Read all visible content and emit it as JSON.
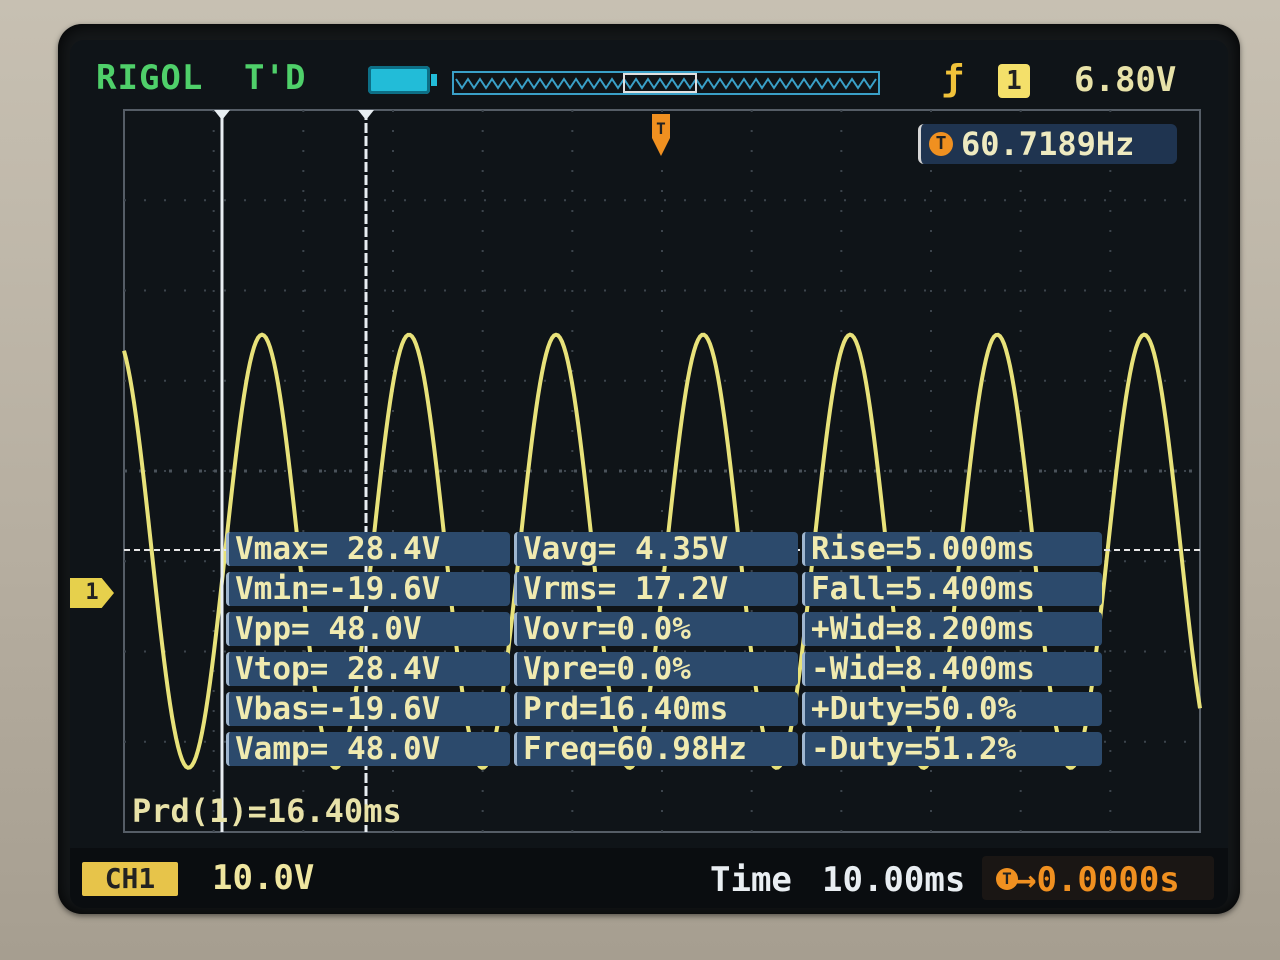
{
  "header": {
    "brand": "RIGOL",
    "trigger_status": "T'D",
    "trigger_source": "1",
    "trigger_level": "6.80V",
    "edge_icon": "rising-edge-icon",
    "battery_icon": "battery-icon"
  },
  "freq_counter": {
    "label": "T",
    "value": "60.7189Hz"
  },
  "measurements": {
    "rows": [
      [
        "Vmax= 28.4V",
        "Vavg= 4.35V",
        "Rise=5.000ms"
      ],
      [
        "Vmin=-19.6V",
        "Vrms= 17.2V",
        "Fall=5.400ms"
      ],
      [
        "Vpp= 48.0V",
        "Vovr=0.0%",
        "+Wid=8.200ms"
      ],
      [
        "Vtop= 28.4V",
        "Vpre=0.0%",
        "-Wid=8.400ms"
      ],
      [
        "Vbas=-19.6V",
        "Prd=16.40ms",
        "+Duty=50.0%"
      ],
      [
        "Vamp= 48.0V",
        "Freq=60.98Hz",
        "-Duty=51.2%"
      ]
    ]
  },
  "cursor_readout": "Prd(1)=16.40ms",
  "channel": {
    "badge": "CH1",
    "marker": "1",
    "scale": "10.0V"
  },
  "timebase": {
    "label": "Time",
    "scale": "10.00ms",
    "offset_label": "T",
    "offset": "0.0000s"
  },
  "colors": {
    "trace": "#e8e27a",
    "accent_green": "#4fd06a",
    "panel": "#2c4a6c",
    "trigger": "#f09020"
  },
  "waveform": {
    "type": "sine",
    "frequency_hz": 60.98,
    "vmax": 28.4,
    "vmin": -19.6,
    "volts_per_div": 10.0,
    "time_per_div_ms": 10.0
  }
}
